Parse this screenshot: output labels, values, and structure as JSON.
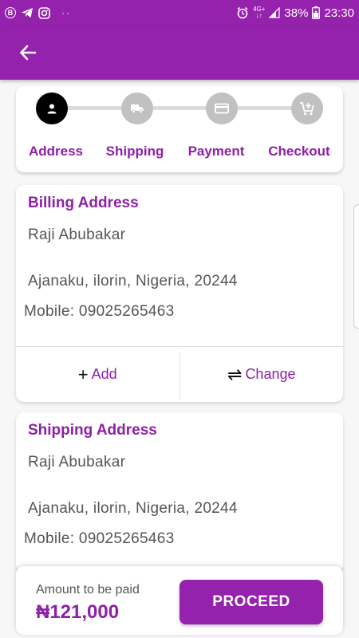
{
  "status_bar": {
    "icons_left": [
      "b-bubble-icon",
      "telegram-icon",
      "instagram-icon",
      "more-dots-icon"
    ],
    "b_glyph": "B",
    "dots": "··",
    "network_top": "4G+",
    "network_bottom": "↓↑",
    "battery": "38%",
    "time": "23:30"
  },
  "app_bar": {
    "back_icon": "arrow-left-icon"
  },
  "stepper": {
    "steps": [
      {
        "label": "Address",
        "icon": "person-icon",
        "active": true
      },
      {
        "label": "Shipping",
        "icon": "truck-icon",
        "active": false
      },
      {
        "label": "Payment",
        "icon": "card-icon",
        "active": false
      },
      {
        "label": "Checkout",
        "icon": "cart-add-icon",
        "active": false
      }
    ]
  },
  "billing": {
    "title": "Billing Address",
    "name": "Raji Abubakar",
    "address": "Ajanaku, ilorin,  Nigeria, 20244",
    "mobile": "Mobile: 09025265463",
    "add_label": "Add",
    "change_label": "Change"
  },
  "shipping": {
    "title": "Shipping Address",
    "name": "Raji Abubakar",
    "address": "Ajanaku, ilorin,  Nigeria, 20244",
    "mobile": "Mobile: 09025265463"
  },
  "footer": {
    "amount_label": "Amount to be paid",
    "amount_value": "₦121,000",
    "proceed_label": "PROCEED"
  },
  "colors": {
    "primary": "#9522ad",
    "accent_text": "#8e1fa6",
    "inactive_step": "#c1c1c1"
  }
}
